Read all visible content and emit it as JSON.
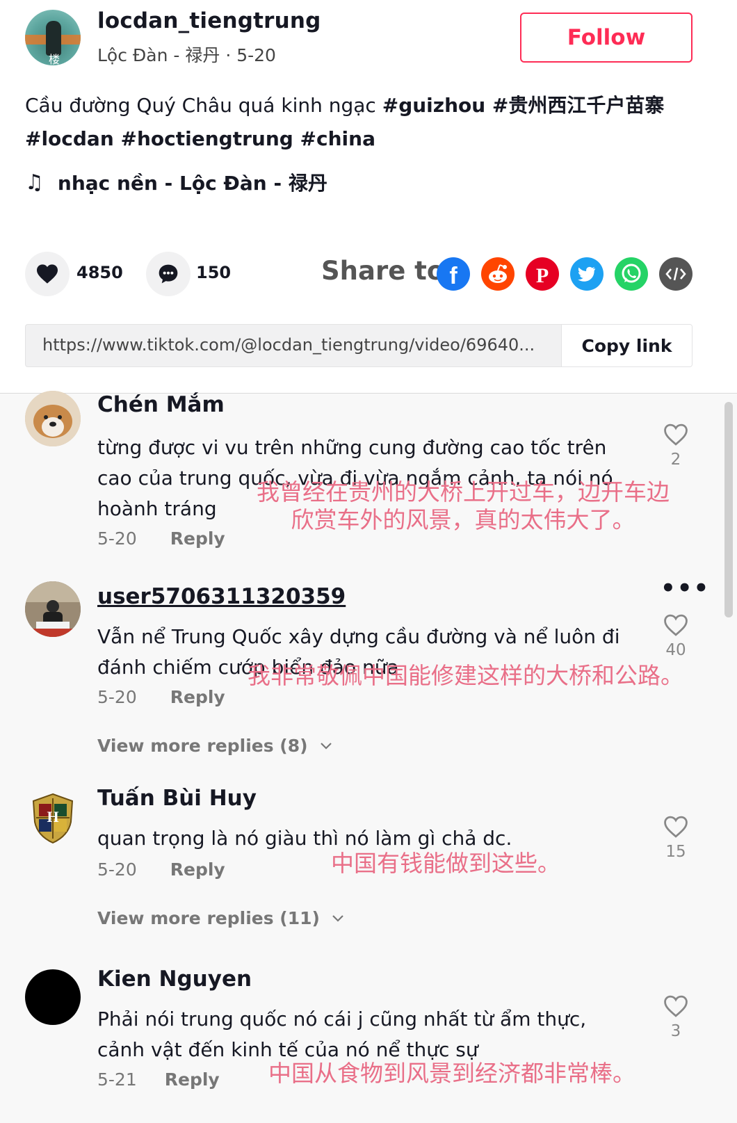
{
  "post": {
    "author_name": "locdan_tiengtrung",
    "author_sub": "Lộc Đàn - 禄丹 · 5-20",
    "follow_label": "Follow",
    "caption_text": "Cầu đường Quý Châu quá kinh ngạc ",
    "caption_tags_1": "#guizhou #贵州西江千户苗寨",
    "caption_tags_2": "#locdan #hoctiengtrung #china",
    "music_note": "♫",
    "music_label": "nhạc nền - Lộc Đàn - 禄丹"
  },
  "actions": {
    "likes": "4850",
    "comments": "150",
    "share_label": "Share to",
    "share_icons": [
      "facebook-icon",
      "reddit-icon",
      "pinterest-icon",
      "twitter-icon",
      "whatsapp-icon",
      "embed-icon"
    ],
    "colors": {
      "facebook": "#1877f2",
      "reddit": "#ff4500",
      "pinterest": "#e60023",
      "twitter": "#1da1f2",
      "whatsapp": "#25d366",
      "embed": "#555555",
      "accent": "#fe2c55",
      "translation": "#e96f88"
    }
  },
  "link": {
    "url": "https://www.tiktok.com/@locdan_tiengtrung/video/69640...",
    "copy_label": "Copy link"
  },
  "comments": [
    {
      "name": "Chén Mắm",
      "text": "từng được vi vu trên những cung đường cao tốc trên cao của trung quốc, vừa đi vừa ngắm cảnh, ta nói nó hoành tráng",
      "date": "5-20",
      "reply": "Reply",
      "likes": "2",
      "translation_1": "我曾经在贵州的大桥上开过车，边开车边",
      "translation_2": "欣赏车外的风景，真的太伟大了。"
    },
    {
      "name": "user5706311320359",
      "text": "Vẫn nể Trung Quốc xây dựng cầu đường và nể luôn đi đánh chiếm cướp biển đảo nữa",
      "date": "5-20",
      "reply": "Reply",
      "likes": "40",
      "more_menu": "•••",
      "translation_1": "我非常敬佩中国能修建这样的大桥和公路。",
      "view_more": "View more replies (8)"
    },
    {
      "name": "Tuấn Bùi Huy",
      "text": "quan trọng là nó giàu thì nó làm gì chả dc.",
      "date": "5-20",
      "reply": "Reply",
      "likes": "15",
      "translation_1": "中国有钱能做到这些。",
      "view_more": "View more replies (11)"
    },
    {
      "name": "Kien Nguyen",
      "text": "Phải nói trung quốc nó cái j cũng nhất từ ẩm thực, cảnh vật đến kinh tế của nó nể thực sự",
      "date": "5-21",
      "reply": "Reply",
      "likes": "3",
      "translation_1": "中国从食物到风景到经济都非常棒。"
    }
  ]
}
